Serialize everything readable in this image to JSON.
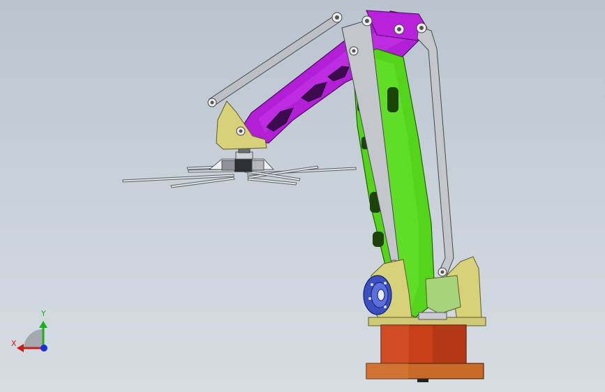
{
  "viewport": {
    "background_top": "#b9c4cf",
    "background_bottom": "#d6dce2"
  },
  "model": {
    "parts": [
      {
        "name": "gripper",
        "color": "#e6e8ec"
      },
      {
        "name": "upper-arm",
        "color": "#b21fd6"
      },
      {
        "name": "lower-arm",
        "color": "#55d41c"
      },
      {
        "name": "parallel-links",
        "color": "#b7b9bd"
      },
      {
        "name": "yoke",
        "color": "#d7d17a"
      },
      {
        "name": "motor-flange",
        "color": "#3a4fc2"
      },
      {
        "name": "base-column",
        "color": "#c8401a"
      },
      {
        "name": "base-plate",
        "color": "#c86a2a"
      }
    ]
  },
  "triad": {
    "x_label": "X",
    "y_label": "Y",
    "x_color": "#d11a1a",
    "y_color": "#16b316",
    "z_color": "#1a2fd6"
  }
}
